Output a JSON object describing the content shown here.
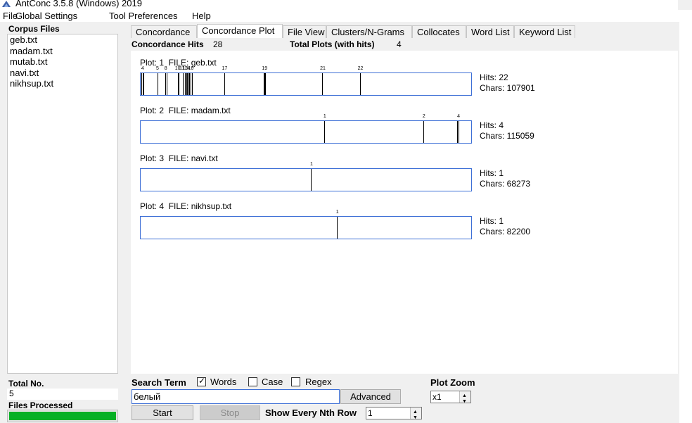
{
  "window": {
    "title": "AntConc 3.5.8 (Windows) 2019"
  },
  "menu": [
    "File",
    "Global Settings",
    "Tool Preferences",
    "Help"
  ],
  "corpus": {
    "header": "Corpus Files",
    "files": [
      "geb.txt",
      "madam.txt",
      "mutab.txt",
      "navi.txt",
      "nikhsup.txt"
    ],
    "total_label": "Total No.",
    "total_value": "5",
    "files_processed_label": "Files Processed",
    "files_processed_progress": 1.0
  },
  "tabs": [
    "Concordance",
    "Concordance Plot",
    "File View",
    "Clusters/N-Grams",
    "Collocates",
    "Word List",
    "Keyword List"
  ],
  "active_tab": "Concordance Plot",
  "stats": {
    "hits_label": "Concordance Hits",
    "hits_value": "28",
    "plots_label": "Total Plots (with hits)",
    "plots_value": "4"
  },
  "plots": [
    {
      "plot_label": "Plot: 1",
      "file_label": "FILE: geb.txt",
      "hits": "Hits: 22",
      "chars": "Chars: 107901",
      "hit_positions": [
        0.003,
        0.006,
        0.008,
        0.051,
        0.074,
        0.078,
        0.112,
        0.116,
        0.128,
        0.135,
        0.138,
        0.141,
        0.144,
        0.148,
        0.152,
        0.155,
        0.254,
        0.373,
        0.375,
        0.378,
        0.551,
        0.665
      ],
      "labels": [
        {
          "text": "4",
          "pos": 0.006
        },
        {
          "text": "5",
          "pos": 0.051
        },
        {
          "text": "8",
          "pos": 0.076
        },
        {
          "text": "10",
          "pos": 0.112
        },
        {
          "text": "11",
          "pos": 0.125
        },
        {
          "text": "13",
          "pos": 0.135
        },
        {
          "text": "14",
          "pos": 0.141
        },
        {
          "text": "16",
          "pos": 0.152
        },
        {
          "text": "17",
          "pos": 0.254
        },
        {
          "text": "19",
          "pos": 0.375
        },
        {
          "text": "21",
          "pos": 0.551
        },
        {
          "text": "22",
          "pos": 0.665
        }
      ]
    },
    {
      "plot_label": "Plot: 2",
      "file_label": "FILE: madam.txt",
      "hits": "Hits: 4",
      "chars": "Chars: 115059",
      "hit_positions": [
        0.557,
        0.857,
        0.96,
        0.964
      ],
      "labels": [
        {
          "text": "1",
          "pos": 0.557
        },
        {
          "text": "2",
          "pos": 0.857
        },
        {
          "text": "4",
          "pos": 0.962
        }
      ]
    },
    {
      "plot_label": "Plot: 3",
      "file_label": "FILE: navi.txt",
      "hits": "Hits: 1",
      "chars": "Chars: 68273",
      "hit_positions": [
        0.517
      ],
      "labels": [
        {
          "text": "1",
          "pos": 0.517
        }
      ]
    },
    {
      "plot_label": "Plot: 4",
      "file_label": "FILE: nikhsup.txt",
      "hits": "Hits: 1",
      "chars": "Chars: 82200",
      "hit_positions": [
        0.595
      ],
      "labels": [
        {
          "text": "1",
          "pos": 0.595
        }
      ]
    }
  ],
  "search": {
    "label": "Search Term",
    "words_label": "Words",
    "words_checked": true,
    "case_label": "Case",
    "case_checked": false,
    "regex_label": "Regex",
    "regex_checked": false,
    "value": "белый",
    "advanced_label": "Advanced",
    "start_label": "Start",
    "stop_label": "Stop",
    "nth_label": "Show Every Nth Row",
    "nth_value": "1"
  },
  "zoom": {
    "label": "Plot Zoom",
    "value": "x1"
  }
}
